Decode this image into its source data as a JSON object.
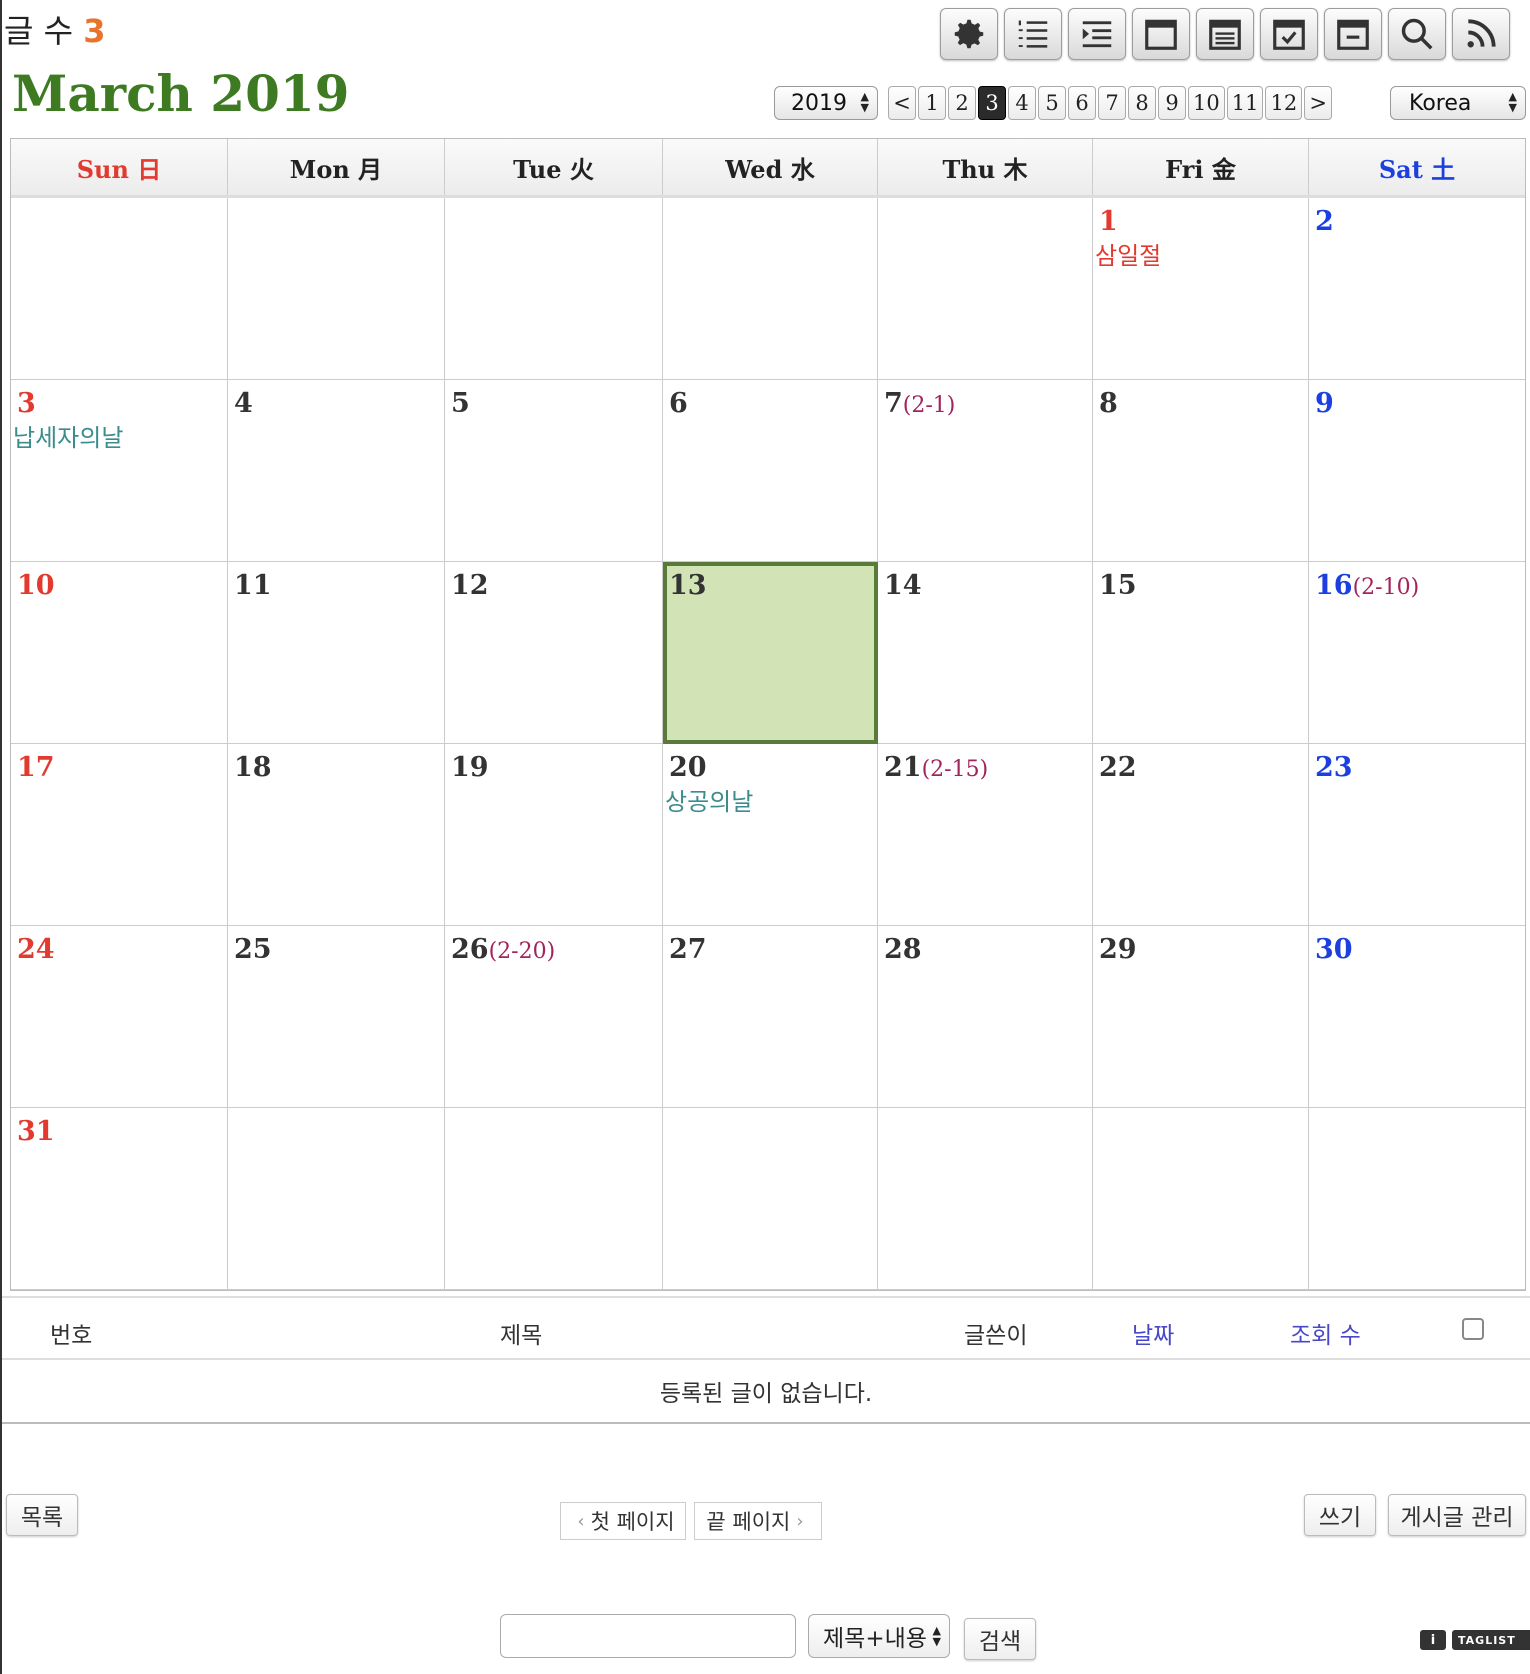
{
  "header": {
    "post_count_label": "글 수",
    "post_count": "3",
    "month_title": "March 2019",
    "year_value": "2019",
    "country_value": "Korea",
    "toolbar_icons": [
      "gear-icon",
      "numbered-list-icon",
      "indent-list-icon",
      "month-view-icon",
      "list-view-icon",
      "check-calendar-icon",
      "minus-calendar-icon",
      "search-icon",
      "rss-icon"
    ]
  },
  "month_nav": {
    "prev": "<",
    "next": ">",
    "months": [
      "1",
      "2",
      "3",
      "4",
      "5",
      "6",
      "7",
      "8",
      "9",
      "10",
      "11",
      "12"
    ],
    "active_month": "3"
  },
  "weekdays": [
    "Sun 日",
    "Mon 月",
    "Tue 火",
    "Wed 水",
    "Thu 木",
    "Fri 金",
    "Sat 土"
  ],
  "weeks": [
    [
      {
        "day": ""
      },
      {
        "day": ""
      },
      {
        "day": ""
      },
      {
        "day": ""
      },
      {
        "day": ""
      },
      {
        "day": "1",
        "holiday": "삼일절",
        "type": "sun"
      },
      {
        "day": "2",
        "type": "sat"
      }
    ],
    [
      {
        "day": "3",
        "event": "납세자의날",
        "type": "sun"
      },
      {
        "day": "4"
      },
      {
        "day": "5"
      },
      {
        "day": "6"
      },
      {
        "day": "7",
        "lunar": "(2-1)"
      },
      {
        "day": "8"
      },
      {
        "day": "9",
        "type": "sat"
      }
    ],
    [
      {
        "day": "10",
        "type": "sun"
      },
      {
        "day": "11"
      },
      {
        "day": "12"
      },
      {
        "day": "13",
        "today": true
      },
      {
        "day": "14"
      },
      {
        "day": "15"
      },
      {
        "day": "16",
        "lunar": "(2-10)",
        "type": "sat"
      }
    ],
    [
      {
        "day": "17",
        "type": "sun"
      },
      {
        "day": "18"
      },
      {
        "day": "19"
      },
      {
        "day": "20",
        "event": "상공의날"
      },
      {
        "day": "21",
        "lunar": "(2-15)"
      },
      {
        "day": "22"
      },
      {
        "day": "23",
        "type": "sat"
      }
    ],
    [
      {
        "day": "24",
        "type": "sun"
      },
      {
        "day": "25"
      },
      {
        "day": "26",
        "lunar": "(2-20)"
      },
      {
        "day": "27"
      },
      {
        "day": "28"
      },
      {
        "day": "29"
      },
      {
        "day": "30",
        "type": "sat"
      }
    ],
    [
      {
        "day": "31",
        "type": "sun"
      },
      {
        "day": ""
      },
      {
        "day": ""
      },
      {
        "day": ""
      },
      {
        "day": ""
      },
      {
        "day": ""
      },
      {
        "day": ""
      }
    ]
  ],
  "list": {
    "col_number": "번호",
    "col_title": "제목",
    "col_author": "글쓴이",
    "col_date": "날짜",
    "col_views": "조회 수",
    "empty_message": "등록된 글이 없습니다."
  },
  "buttons": {
    "list": "목록",
    "first_page": "첫 페이지",
    "last_page": "끝 페이지",
    "write": "쓰기",
    "manage": "게시글 관리",
    "search": "검색"
  },
  "search": {
    "scope_value": "제목+내용",
    "input_value": ""
  },
  "footer": {
    "info_badge": "i",
    "taglist_badge": "TAGLIST"
  },
  "colors": {
    "title_green": "#3d7a22",
    "sunday_red": "#e23a2e",
    "saturday_blue": "#1c3fe0",
    "lunar_purple": "#a3245c",
    "event_teal": "#3b8c8c",
    "today_bg": "#d2e4b5",
    "today_border": "#5a7a3a",
    "count_orange": "#e8742b"
  }
}
